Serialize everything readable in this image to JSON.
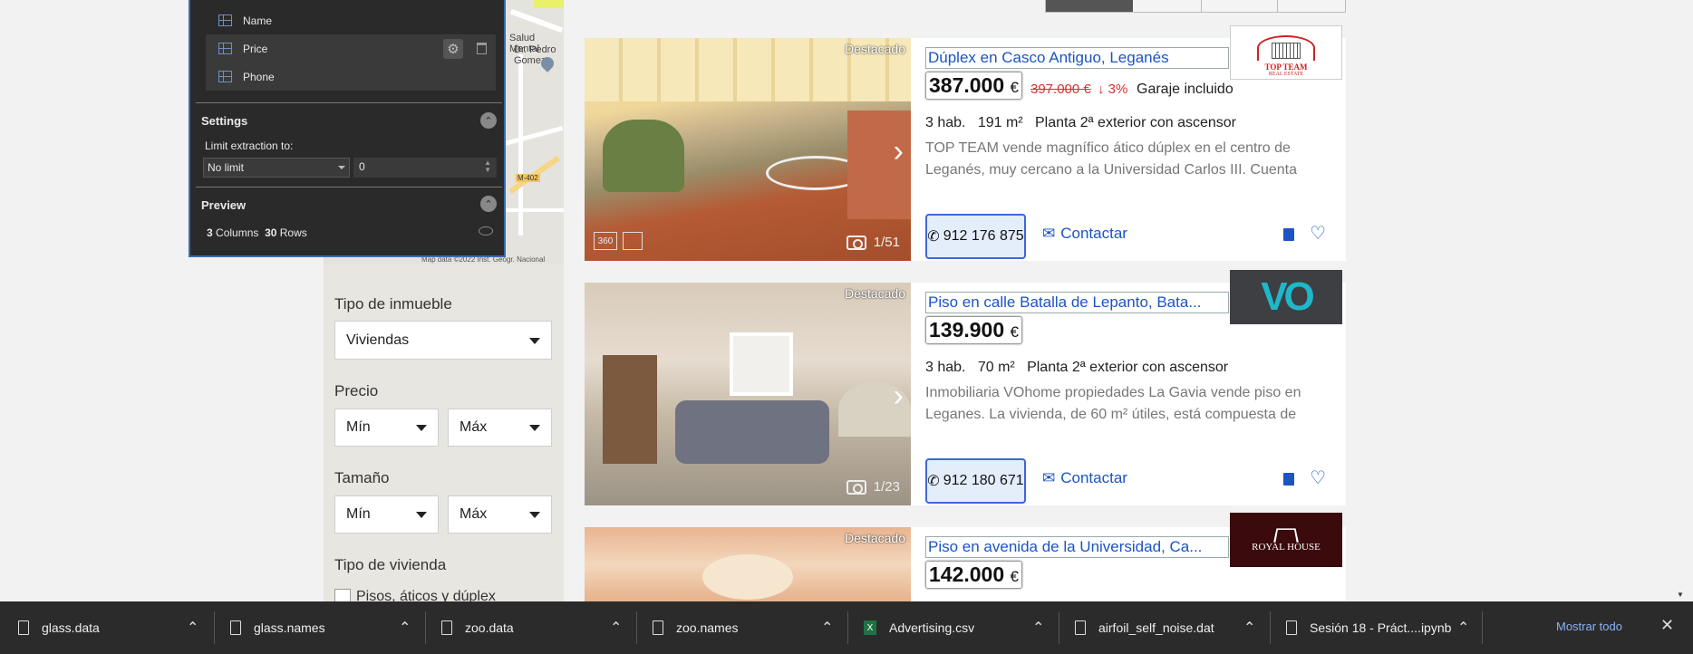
{
  "extraction_panel": {
    "fields": [
      "Name",
      "Price",
      "Phone"
    ],
    "settings_label": "Settings",
    "limit_label": "Limit extraction to:",
    "limit_select": "No limit",
    "limit_value": "0",
    "preview_label": "Preview",
    "columns_count": "3",
    "columns_label": "Columns",
    "rows_count": "30",
    "rows_label": "Rows"
  },
  "map": {
    "labels": [
      "Salud Mental",
      "Dr. Pedro Gomez",
      "M-402",
      "Map data ©2022 Inst. Geogr. Nacional"
    ]
  },
  "filters": {
    "property_type_label": "Tipo de inmueble",
    "property_type_value": "Viviendas",
    "price_label": "Precio",
    "size_label": "Tamaño",
    "min_label": "Mín",
    "max_label": "Máx",
    "dwelling_type_label": "Tipo de vivienda",
    "dwelling_option": "Pisos, áticos y dúplex"
  },
  "listings": [
    {
      "badge": "Destacado",
      "title": "Dúplex en Casco Antiguo, Leganés",
      "price": "387.000",
      "currency": "€",
      "old_price": "397.000 €",
      "drop": "3%",
      "extra": "Garaje incluido",
      "rooms": "3 hab.",
      "size": "191 m²",
      "floor": "Planta 2ª exterior con ascensor",
      "desc": "TOP TEAM vende magnífico ático dúplex en el centro de Leganés, muy cercano a la Universidad Carlos III. Cuenta con",
      "photo_count": "1/51",
      "phone": "912 176 875",
      "contact": "Contactar",
      "agency": "TOP TEAM",
      "agency_sub": "REAL ESTATE"
    },
    {
      "badge": "Destacado",
      "title": "Piso en calle Batalla de Lepanto, Bata...",
      "price": "139.900",
      "currency": "€",
      "rooms": "3 hab.",
      "size": "70 m²",
      "floor": "Planta 2ª exterior con ascensor",
      "desc": "Inmobiliaria VOhome propiedades La Gavia vende piso en Leganes. La vivienda, de 60 m² útiles, está compuesta de",
      "photo_count": "1/23",
      "phone": "912 180 671",
      "contact": "Contactar",
      "agency": "VO"
    },
    {
      "badge": "Destacado",
      "title": "Piso en avenida de la Universidad, Ca...",
      "price": "142.000",
      "currency": "€",
      "agency": "ROYAL HOUSE"
    }
  ],
  "downloads": [
    {
      "name": "glass.data"
    },
    {
      "name": "glass.names"
    },
    {
      "name": "zoo.data"
    },
    {
      "name": "zoo.names"
    },
    {
      "name": "Advertising.csv"
    },
    {
      "name": "airfoil_self_noise.dat"
    },
    {
      "name": "Sesión 18 - Práct....ipynb"
    }
  ],
  "show_all": "Mostrar todo",
  "colors": {
    "link": "#1b54c4",
    "price_drop": "#d43030",
    "panel_bg": "#2a2a2a"
  }
}
